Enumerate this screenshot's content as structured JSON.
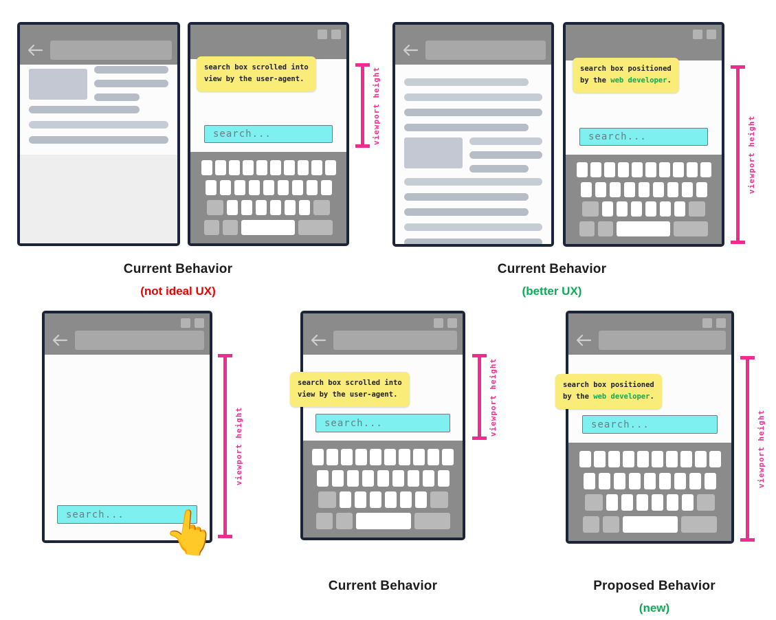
{
  "colors": {
    "accent_pink": "#ef2d91",
    "search_cyan": "#7ff0f0",
    "tooltip_yellow": "#f9ec79",
    "green": "#0fa958",
    "red": "#ee0000",
    "frame_dark": "#1b2438",
    "chrome_grey": "#8b8b8b"
  },
  "measure_label": "viewport height",
  "search_placeholder": "search...",
  "tooltips": {
    "user_agent": {
      "line1": "search box scrolled into",
      "line2_plain": "view by the user-agent."
    },
    "developer": {
      "line1": "search box positioned",
      "line2_plain": "by the ",
      "line2_green": "web developer",
      "line2_end": "."
    }
  },
  "captions": {
    "top_left": {
      "main": "Current Behavior",
      "sub": "(not ideal UX)",
      "sub_color": "#ee0000"
    },
    "top_right": {
      "main": "Current Behavior",
      "sub": "(better UX)",
      "sub_color": "#0fa958"
    },
    "bottom_middle": {
      "main": "Current Behavior",
      "sub": "",
      "sub_color": "#0fa958"
    },
    "bottom_right": {
      "main": "Proposed  Behavior",
      "sub": "(new)",
      "sub_color": "#0fa958"
    }
  },
  "icons": {
    "back": "back-arrow-icon",
    "hand": "pointing-hand-icon"
  },
  "keyboard": {
    "rows": [
      {
        "count": 10,
        "type": "letters"
      },
      {
        "count": 9,
        "type": "letters"
      },
      {
        "count": 9,
        "type": "letters-with-modifiers"
      },
      {
        "count": 4,
        "type": "bottom-row"
      }
    ]
  }
}
